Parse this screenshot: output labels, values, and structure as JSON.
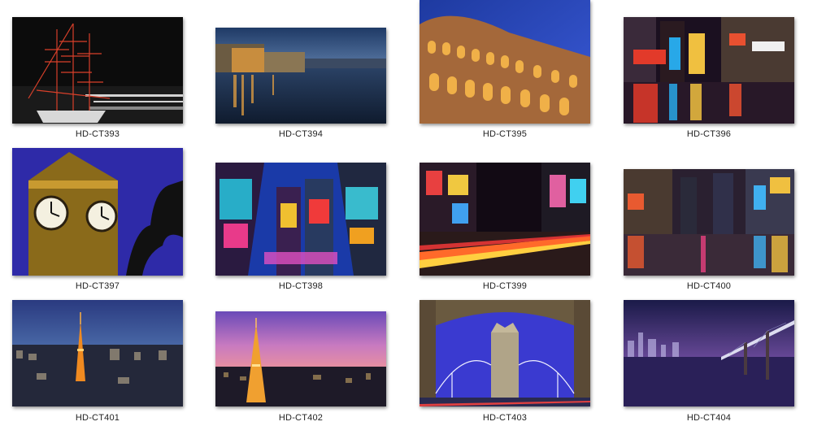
{
  "tiles": [
    {
      "label": "HD-CT393",
      "scene": "tall-ship-night"
    },
    {
      "label": "HD-CT394",
      "scene": "river-city-dusk"
    },
    {
      "label": "HD-CT395",
      "scene": "colosseum-night"
    },
    {
      "label": "HD-CT396",
      "scene": "times-square-rain"
    },
    {
      "label": "HD-CT397",
      "scene": "big-ben-clock"
    },
    {
      "label": "HD-CT398",
      "scene": "times-square-skyscrapers"
    },
    {
      "label": "HD-CT399",
      "scene": "street-light-trails"
    },
    {
      "label": "HD-CT400",
      "scene": "city-street-rain"
    },
    {
      "label": "HD-CT401",
      "scene": "tokyo-tower-city"
    },
    {
      "label": "HD-CT402",
      "scene": "tokyo-tower-sunset"
    },
    {
      "label": "HD-CT403",
      "scene": "tower-bridge-arch"
    },
    {
      "label": "HD-CT404",
      "scene": "bridge-skyline-night"
    }
  ]
}
